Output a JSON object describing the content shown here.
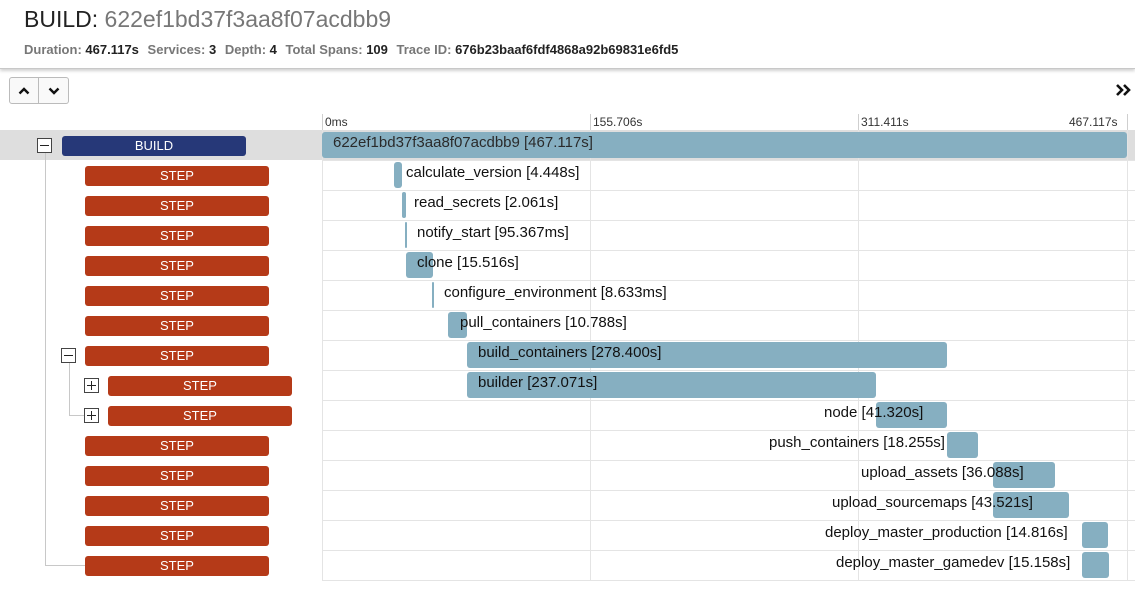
{
  "header": {
    "title_name": "BUILD:",
    "trace_name": "622ef1bd37f3aa8f07acdbb9",
    "stats": [
      {
        "label": "Duration:",
        "value": "467.117s"
      },
      {
        "label": "Services:",
        "value": "3"
      },
      {
        "label": "Depth:",
        "value": "4"
      },
      {
        "label": "Total Spans:",
        "value": "109"
      },
      {
        "label": "Trace ID:",
        "value": "676b23baaf6fdf4868a92b69831e6fd5"
      }
    ]
  },
  "controls": {
    "up_icon": "chevron-up-icon",
    "down_icon": "chevron-down-icon",
    "expand_icon": "double-chevron-right-icon"
  },
  "timeline": {
    "ticks": [
      "0ms",
      "155.706s",
      "311.411s",
      "467.117s"
    ]
  },
  "rows": [
    {
      "service": "BUILD",
      "label": "622ef1bd37f3aa8f07acdbb9 [467.117s]",
      "toggle": "collapse"
    },
    {
      "service": "STEP",
      "label": "calculate_version [4.448s]"
    },
    {
      "service": "STEP",
      "label": "read_secrets [2.061s]"
    },
    {
      "service": "STEP",
      "label": "notify_start [95.367ms]"
    },
    {
      "service": "STEP",
      "label": "clone [15.516s]"
    },
    {
      "service": "STEP",
      "label": "configure_environment [8.633ms]"
    },
    {
      "service": "STEP",
      "label": "pull_containers [10.788s]"
    },
    {
      "service": "STEP",
      "label": "build_containers [278.400s]",
      "toggle": "collapse"
    },
    {
      "service": "STEP",
      "label": "builder [237.071s]",
      "toggle": "expand"
    },
    {
      "service": "STEP",
      "label": "node [41.320s]",
      "toggle": "expand"
    },
    {
      "service": "STEP",
      "label": "push_containers [18.255s]"
    },
    {
      "service": "STEP",
      "label": "upload_assets [36.088s]"
    },
    {
      "service": "STEP",
      "label": "upload_sourcemaps [43.521s]"
    },
    {
      "service": "STEP",
      "label": "deploy_master_production [14.816s]"
    },
    {
      "service": "STEP",
      "label": "deploy_master_gamedev [15.158s]"
    }
  ]
}
